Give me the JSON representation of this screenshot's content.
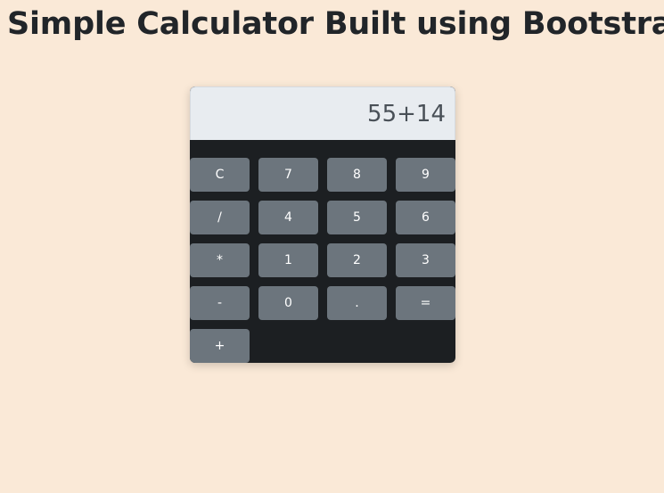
{
  "page": {
    "title": "Simple Calculator Built using Bootstrap"
  },
  "calculator": {
    "display_value": "55+14",
    "keys": {
      "clear": "C",
      "seven": "7",
      "eight": "8",
      "nine": "9",
      "divide": "/",
      "four": "4",
      "five": "5",
      "six": "6",
      "multiply": "*",
      "one": "1",
      "two": "2",
      "three": "3",
      "subtract": "-",
      "zero": "0",
      "decimal": ".",
      "equals": "=",
      "add": "+"
    }
  },
  "colors": {
    "page_background": "#fae9d7",
    "calculator_body": "#1c1f22",
    "display_background": "#e8ecf0",
    "key_background": "#6c757d",
    "key_text": "#ffffff",
    "title_text": "#212529"
  }
}
